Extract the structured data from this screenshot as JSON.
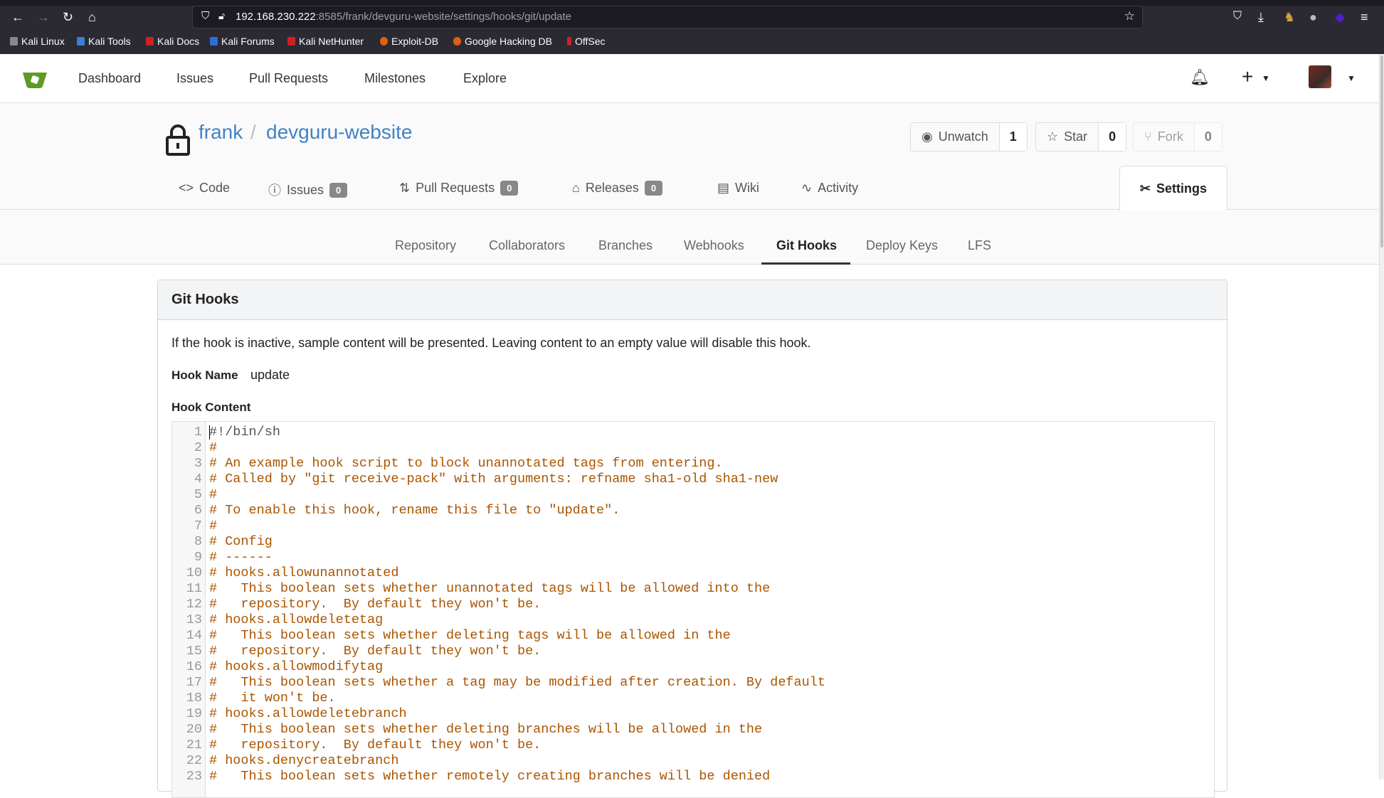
{
  "browser": {
    "url_host": "192.168.230.222",
    "url_path": ":8585/frank/devguru-website/settings/hooks/git/update",
    "bookmarks": [
      "Kali Linux",
      "Kali Tools",
      "Kali Docs",
      "Kali Forums",
      "Kali NetHunter",
      "Exploit-DB",
      "Google Hacking DB",
      "OffSec"
    ]
  },
  "nav": {
    "items": [
      "Dashboard",
      "Issues",
      "Pull Requests",
      "Milestones",
      "Explore"
    ]
  },
  "repo": {
    "owner": "frank",
    "separator": "/",
    "name": "devguru-website",
    "unwatch": {
      "label": "Unwatch",
      "count": "1"
    },
    "star": {
      "label": "Star",
      "count": "0"
    },
    "fork": {
      "label": "Fork",
      "count": "0"
    },
    "tabs": [
      {
        "label": "Code"
      },
      {
        "label": "Issues",
        "badge": "0"
      },
      {
        "label": "Pull Requests",
        "badge": "0"
      },
      {
        "label": "Releases",
        "badge": "0"
      },
      {
        "label": "Wiki"
      },
      {
        "label": "Activity"
      }
    ],
    "settings_tab": "Settings"
  },
  "settings_menu": {
    "items": [
      "Repository",
      "Collaborators",
      "Branches",
      "Webhooks",
      "Git Hooks",
      "Deploy Keys",
      "LFS"
    ],
    "active": "Git Hooks"
  },
  "panel": {
    "title": "Git Hooks",
    "description": "If the hook is inactive, sample content will be presented. Leaving content to an empty value will disable this hook.",
    "hook_name_label": "Hook Name",
    "hook_name": "update",
    "hook_content_label": "Hook Content",
    "code_lines": [
      "#!/bin/sh",
      "#",
      "# An example hook script to block unannotated tags from entering.",
      "# Called by \"git receive-pack\" with arguments: refname sha1-old sha1-new",
      "#",
      "# To enable this hook, rename this file to \"update\".",
      "#",
      "# Config",
      "# ------",
      "# hooks.allowunannotated",
      "#   This boolean sets whether unannotated tags will be allowed into the",
      "#   repository.  By default they won't be.",
      "# hooks.allowdeletetag",
      "#   This boolean sets whether deleting tags will be allowed in the",
      "#   repository.  By default they won't be.",
      "# hooks.allowmodifytag",
      "#   This boolean sets whether a tag may be modified after creation. By default",
      "#   it won't be.",
      "# hooks.allowdeletebranch",
      "#   This boolean sets whether deleting branches will be allowed in the",
      "#   repository.  By default they won't be.",
      "# hooks.denycreatebranch",
      "#   This boolean sets whether remotely creating branches will be denied"
    ]
  },
  "colors": {
    "link": "#4183c4",
    "comment": "#aa5500",
    "gitea_green": "#609926"
  }
}
